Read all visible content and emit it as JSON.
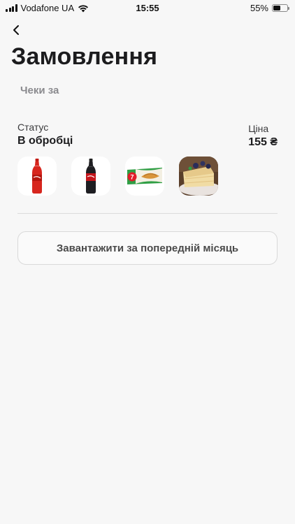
{
  "status_bar": {
    "carrier": "Vodafone UA",
    "time": "15:55",
    "battery_percent": "55%",
    "battery_level": 0.55
  },
  "header": {
    "back_icon": "chevron-left-icon",
    "title": "Замовлення",
    "subtitle": "Чеки за"
  },
  "order": {
    "status_label": "Статус",
    "status_value": "В обробці",
    "price_label": "Ціна",
    "price_value": "155 ₴",
    "products": [
      {
        "name": "coca-cola-bottle",
        "color": "#d7261e"
      },
      {
        "name": "coca-cola-zero-bottle",
        "color": "#1a1a1a"
      },
      {
        "name": "7days-croissant-pack",
        "color": "#2f9e44"
      },
      {
        "name": "blueberry-cake-slice",
        "color": "#c9a36b"
      }
    ]
  },
  "actions": {
    "load_previous_month": "Завантажити за попередній місяць"
  }
}
